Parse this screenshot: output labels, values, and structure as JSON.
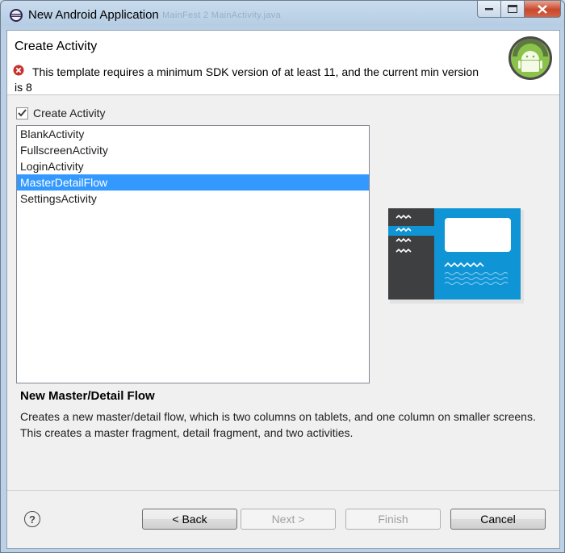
{
  "window": {
    "title": "New Android Application",
    "background_tabs": "MainFest     2 MainActivity.java"
  },
  "header": {
    "page_title": "Create Activity",
    "error_message": "This template requires a minimum SDK version of at least 11, and the current min version is 8"
  },
  "create_activity": {
    "checkbox_label": "Create Activity",
    "checked": true
  },
  "templates": [
    {
      "label": "BlankActivity",
      "selected": false
    },
    {
      "label": "FullscreenActivity",
      "selected": false
    },
    {
      "label": "LoginActivity",
      "selected": false
    },
    {
      "label": "MasterDetailFlow",
      "selected": true
    },
    {
      "label": "SettingsActivity",
      "selected": false
    }
  ],
  "description": {
    "title": "New Master/Detail Flow",
    "text": "Creates a new master/detail flow, which is two columns on tablets, and one column on smaller screens. This creates a master fragment, detail fragment, and two activities."
  },
  "buttons": {
    "back": "< Back",
    "next": "Next >",
    "finish": "Finish",
    "cancel": "Cancel"
  },
  "colors": {
    "selection": "#3399ff",
    "preview_blue": "#0f95d6",
    "preview_dark": "#3d3f40",
    "error_red": "#c9302c"
  }
}
